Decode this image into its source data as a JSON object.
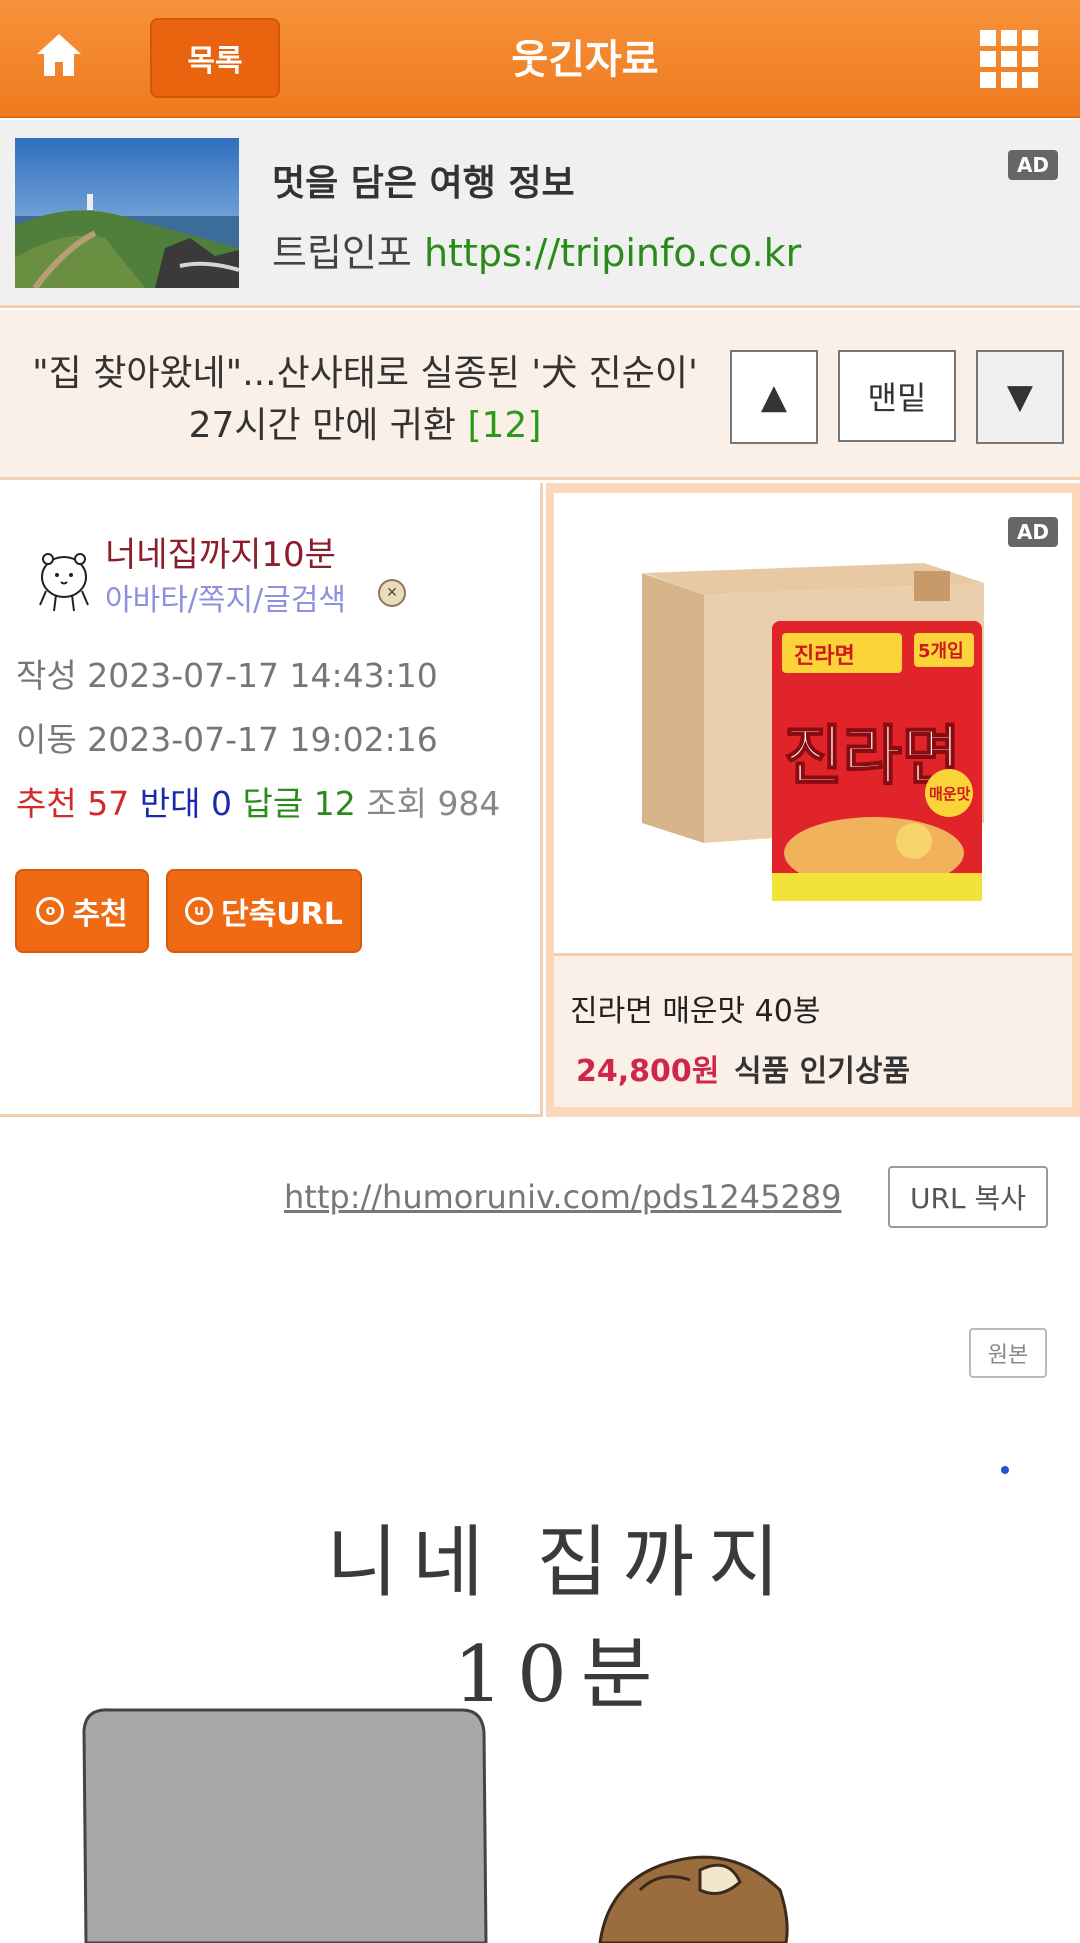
{
  "header": {
    "list_label": "목록",
    "title": "웃긴자료"
  },
  "top_ad": {
    "title": "멋을 담은 여행 정보",
    "advertiser": "트립인포",
    "url": "https://tripinfo.co.kr",
    "tag": "AD"
  },
  "post": {
    "title_text": "\"집 찾아왔네\"...산사태로 실종된 '犬 진순이' 27시간 만에 귀환",
    "comment_count": "[12]",
    "nav_up": "▲",
    "nav_bottom": "맨밑",
    "nav_down": "▼"
  },
  "author": {
    "name": "너네집까지10분",
    "links": "아바타/쪽지/글검색"
  },
  "meta": {
    "written_label": "작성",
    "written": "2023-07-17 14:43:10",
    "moved_label": "이동",
    "moved": "2023-07-17 19:02:16"
  },
  "stats": {
    "recommend_label": "추천",
    "recommend": "57",
    "oppose_label": "반대",
    "oppose": "0",
    "reply_label": "답글",
    "reply": "12",
    "views_label": "조회",
    "views": "984"
  },
  "buttons": {
    "recommend": "추천",
    "recommend_icon": "o",
    "short_url": "단축URL",
    "short_url_icon": "u"
  },
  "product_ad": {
    "tag": "AD",
    "name": "진라면 매운맛 40봉",
    "price": "24,800원",
    "category": "식품 인기상품",
    "package_brand": "진라면",
    "package_count": "5개입",
    "package_flavor": "매운맛"
  },
  "url_row": {
    "link": "http://humoruniv.com/pds1245289",
    "copy_label": "URL 복사",
    "original_label": "원본"
  },
  "comic": {
    "title": "니네 집까지 10분"
  }
}
